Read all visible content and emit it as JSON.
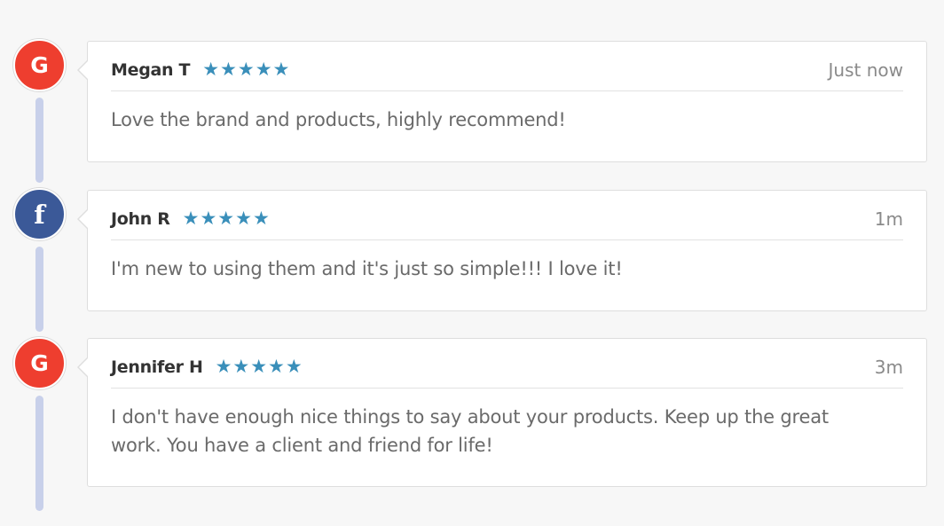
{
  "colors": {
    "google": "#ee3e2f",
    "facebook": "#3b5998",
    "star": "#3a8fba",
    "timeline": "#c8d0ea"
  },
  "reviews": [
    {
      "source": "google",
      "source_icon": "google-icon",
      "source_glyph": "G",
      "name": "Megan T",
      "stars": 5,
      "time": "Just now",
      "text": "Love the brand and products, highly recommend!"
    },
    {
      "source": "facebook",
      "source_icon": "facebook-icon",
      "source_glyph": "f",
      "name": "John R",
      "stars": 5,
      "time": "1m",
      "text": "I'm new to using them and it's just so simple!!! I love it!"
    },
    {
      "source": "google",
      "source_icon": "google-icon",
      "source_glyph": "G",
      "name": "Jennifer H",
      "stars": 5,
      "time": "3m",
      "text": "I don't have enough nice things to say about your products. Keep up the great work. You have a client and friend for life!"
    }
  ]
}
